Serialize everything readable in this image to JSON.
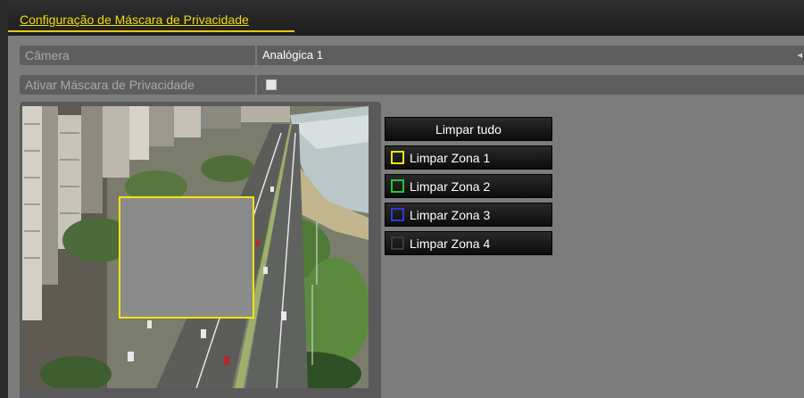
{
  "header": {
    "title": "Configuração de Máscara de Privacidade"
  },
  "settings": {
    "camera_label": "Câmera",
    "camera_value": "Analógica 1",
    "enable_mask_label": "Ativar Máscara de Privacidade",
    "enable_mask_checked": false
  },
  "buttons": {
    "clear_all": "Limpar tudo",
    "zones": [
      {
        "label": "Limpar Zona 1",
        "color": "#f2e411"
      },
      {
        "label": "Limpar Zona 2",
        "color": "#29c53a"
      },
      {
        "label": "Limpar Zona 3",
        "color": "#2b3bd6"
      },
      {
        "label": "Limpar Zona 4",
        "color": "#3a3a3a"
      }
    ]
  },
  "colors": {
    "accent": "#f2dc12",
    "mask_fill": "#8b8b8b"
  }
}
